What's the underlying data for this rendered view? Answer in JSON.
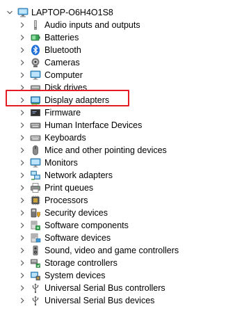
{
  "tree": {
    "root": {
      "label": "LAPTOP-O6H4O1S8",
      "icon": "computer-icon",
      "expanded": true
    },
    "items": [
      {
        "label": "Audio inputs and outputs",
        "icon": "speaker-icon"
      },
      {
        "label": "Batteries",
        "icon": "battery-icon"
      },
      {
        "label": "Bluetooth",
        "icon": "bluetooth-icon"
      },
      {
        "label": "Cameras",
        "icon": "camera-icon"
      },
      {
        "label": "Computer",
        "icon": "monitor-icon"
      },
      {
        "label": "Disk drives",
        "icon": "disk-drive-icon"
      },
      {
        "label": "Display adapters",
        "icon": "display-adapter-icon"
      },
      {
        "label": "Firmware",
        "icon": "firmware-icon"
      },
      {
        "label": "Human Interface Devices",
        "icon": "hid-icon"
      },
      {
        "label": "Keyboards",
        "icon": "keyboard-icon"
      },
      {
        "label": "Mice and other pointing devices",
        "icon": "mouse-icon"
      },
      {
        "label": "Monitors",
        "icon": "monitor-icon"
      },
      {
        "label": "Network adapters",
        "icon": "network-adapter-icon"
      },
      {
        "label": "Print queues",
        "icon": "printer-icon"
      },
      {
        "label": "Processors",
        "icon": "processor-icon"
      },
      {
        "label": "Security devices",
        "icon": "security-device-icon"
      },
      {
        "label": "Software components",
        "icon": "software-component-icon"
      },
      {
        "label": "Software devices",
        "icon": "software-device-icon"
      },
      {
        "label": "Sound, video and game controllers",
        "icon": "sound-controller-icon"
      },
      {
        "label": "Storage controllers",
        "icon": "storage-controller-icon"
      },
      {
        "label": "System devices",
        "icon": "system-device-icon"
      },
      {
        "label": "Universal Serial Bus controllers",
        "icon": "usb-icon"
      },
      {
        "label": "Universal Serial Bus devices",
        "icon": "usb-icon"
      }
    ]
  },
  "highlight": {
    "target": "Display adapters",
    "color": "#e51b24"
  },
  "colors": {
    "chevron": "#5a5a5a",
    "text": "#000000",
    "background": "#ffffff"
  }
}
